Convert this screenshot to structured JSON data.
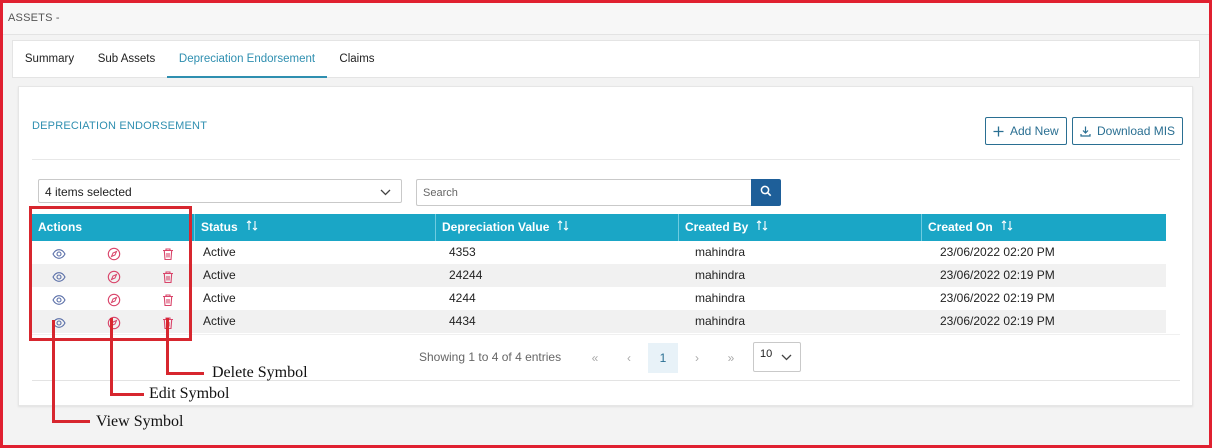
{
  "header": {
    "title": "ASSETS -"
  },
  "tabs": [
    {
      "label": "Summary"
    },
    {
      "label": "Sub Assets"
    },
    {
      "label": "Depreciation Endorsement"
    },
    {
      "label": "Claims"
    }
  ],
  "section": {
    "title": "DEPRECIATION ENDORSEMENT",
    "add_new_label": "Add New",
    "download_label": "Download MIS"
  },
  "filters": {
    "column_select_value": "4 items selected",
    "search_placeholder": "Search"
  },
  "table": {
    "headers": {
      "actions": "Actions",
      "status": "Status",
      "depreciation_value": "Depreciation Value",
      "created_by": "Created By",
      "created_on": "Created On"
    },
    "rows": [
      {
        "status": "Active",
        "depreciation_value": "4353",
        "created_by": "mahindra",
        "created_on": "23/06/2022 02:20 PM"
      },
      {
        "status": "Active",
        "depreciation_value": "24244",
        "created_by": "mahindra",
        "created_on": "23/06/2022 02:19 PM"
      },
      {
        "status": "Active",
        "depreciation_value": "4244",
        "created_by": "mahindra",
        "created_on": "23/06/2022 02:19 PM"
      },
      {
        "status": "Active",
        "depreciation_value": "4434",
        "created_by": "mahindra",
        "created_on": "23/06/2022 02:19 PM"
      }
    ],
    "action_icons": [
      "eye-icon",
      "compass-edit-icon",
      "trash-icon"
    ]
  },
  "pagination": {
    "info": "Showing 1 to 4 of 4 entries",
    "first": "«",
    "prev": "‹",
    "current_page": "1",
    "next": "›",
    "last": "»",
    "page_size": "10"
  },
  "annotations": {
    "delete": "Delete Symbol",
    "edit": "Edit Symbol",
    "view": "View Symbol"
  },
  "colors": {
    "accent": "#2f8fb0",
    "table_header": "#1aa6c6",
    "search_button": "#1e5f99",
    "view_icon": "#5a6fa8",
    "edit_delete_icon": "#d9446a",
    "annotation": "#d7262e"
  }
}
